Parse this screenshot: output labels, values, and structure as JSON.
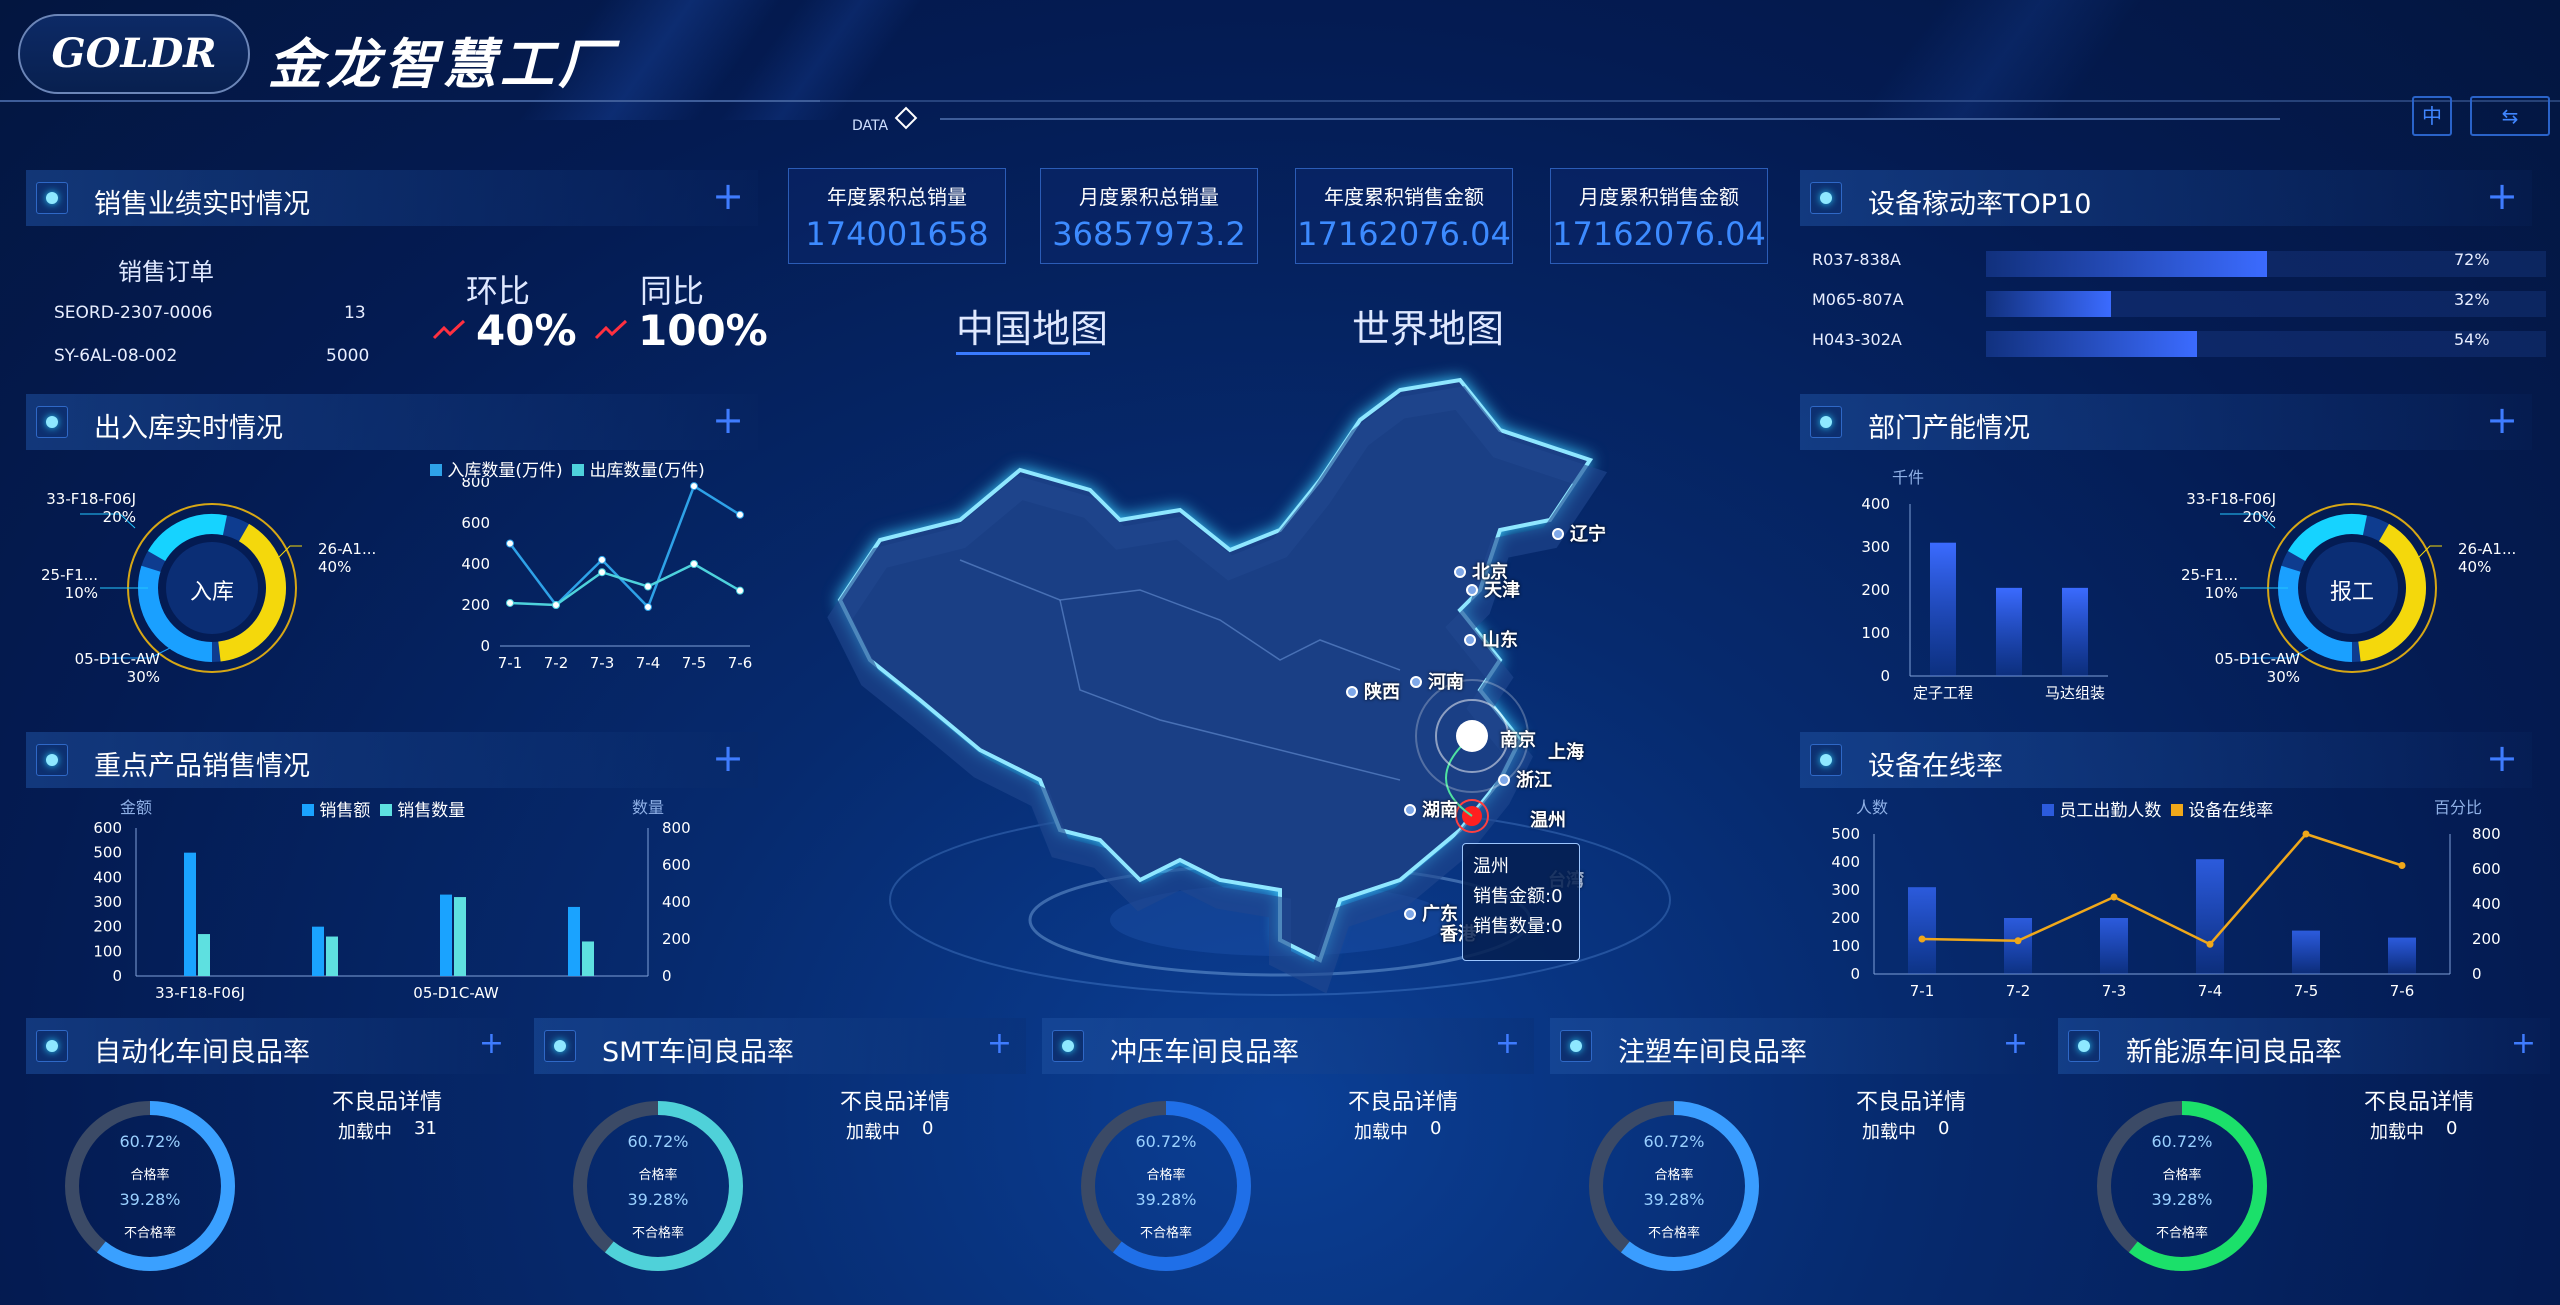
{
  "header": {
    "logo": "GOLDR",
    "title": "金龙智慧工厂",
    "data_label": "DATA",
    "icons": [
      "translate-icon",
      "switch-icon"
    ]
  },
  "sales": {
    "title": "销售业绩实时情况",
    "orders_title": "销售订单",
    "orders": [
      {
        "id": "SEORD-2307-0006",
        "qty": "13"
      },
      {
        "id": "SY-6AL-08-002",
        "qty": "5000"
      }
    ],
    "mom_label": "环比",
    "mom_value": "40%",
    "yoy_label": "同比",
    "yoy_value": "100%"
  },
  "kpis": [
    {
      "label": "年度累积总销量",
      "value": "174001658"
    },
    {
      "label": "月度累积总销量",
      "value": "36857973.2"
    },
    {
      "label": "年度累积销售金额",
      "value": "17162076.04"
    },
    {
      "label": "月度累积销售金额",
      "value": "17162076.04"
    }
  ],
  "map": {
    "tab_china": "中国地图",
    "tab_world": "世界地图",
    "cities": [
      "辽宁",
      "北京",
      "天津",
      "山东",
      "河南",
      "陕西",
      "南京",
      "上海",
      "浙江",
      "湖南",
      "温州",
      "台湾",
      "广东",
      "香港"
    ],
    "tooltip": {
      "city": "温州",
      "amount_label": "销售金额:",
      "amount": "0",
      "qty_label": "销售数量:",
      "qty": "0"
    }
  },
  "warehouse": {
    "title": "出入库实时情况",
    "donut_center": "入库",
    "segments": [
      {
        "name": "33-F18-F06J",
        "pct": "20%"
      },
      {
        "name": "26-A1...",
        "pct": "40%"
      },
      {
        "name": "25-F1...",
        "pct": "10%"
      },
      {
        "name": "05-D1C-AW",
        "pct": "30%"
      }
    ],
    "chart_data": {
      "type": "line",
      "x": [
        "7-1",
        "7-2",
        "7-3",
        "7-4",
        "7-5",
        "7-6"
      ],
      "series": [
        {
          "name": "入库数量(万件)",
          "values": [
            500,
            200,
            420,
            190,
            780,
            640
          ],
          "color": "#2ea2e8"
        },
        {
          "name": "出库数量(万件)",
          "values": [
            210,
            200,
            360,
            290,
            400,
            270
          ],
          "color": "#4ed2dc"
        }
      ],
      "ylim": [
        0,
        800
      ],
      "yticks": [
        "0",
        "200",
        "400",
        "600",
        "800"
      ]
    }
  },
  "products": {
    "title": "重点产品销售情况",
    "ylabel_left": "金额",
    "ylabel_right": "数量",
    "chart_data": {
      "type": "bar",
      "categories": [
        "33-F18-F06J",
        "",
        "05-D1C-AW",
        ""
      ],
      "tick_labels": [
        "33-F18-F06J",
        "05-D1C-AW"
      ],
      "series": [
        {
          "name": "销售额",
          "values": [
            500,
            200,
            330,
            280
          ],
          "color": "#1aa3ff"
        },
        {
          "name": "销售数量",
          "values": [
            170,
            160,
            320,
            140
          ],
          "color": "#5ee0e0"
        }
      ],
      "ylim_left": [
        0,
        600
      ],
      "yticks_left": [
        "0",
        "100",
        "200",
        "300",
        "400",
        "500",
        "600"
      ],
      "yticks_right": [
        "0",
        "200",
        "400",
        "600",
        "800"
      ]
    }
  },
  "equipment": {
    "title": "设备稼动率TOP10",
    "rows": [
      {
        "name": "R037-838A",
        "pct": "72%",
        "value": 72
      },
      {
        "name": "M065-807A",
        "pct": "32%",
        "value": 32
      },
      {
        "name": "H043-302A",
        "pct": "54%",
        "value": 54
      }
    ]
  },
  "dept": {
    "title": "部门产能情况",
    "ylabel": "千件",
    "chart_data": {
      "type": "bar",
      "categories": [
        "定子工程",
        "",
        "马达组装"
      ],
      "values": [
        310,
        205,
        205
      ],
      "ylim": [
        0,
        400
      ],
      "yticks": [
        "0",
        "100",
        "200",
        "300",
        "400"
      ],
      "tick_labels": [
        "定子工程",
        "马达组装"
      ]
    },
    "donut_center": "报工",
    "segments": [
      {
        "name": "33-F18-F06J",
        "pct": "20%"
      },
      {
        "name": "26-A1...",
        "pct": "40%"
      },
      {
        "name": "25-F1...",
        "pct": "10%"
      },
      {
        "name": "05-D1C-AW",
        "pct": "30%"
      }
    ]
  },
  "online": {
    "title": "设备在线率",
    "ylabel_left": "人数",
    "ylabel_right": "百分比",
    "chart_data": {
      "type": "bar",
      "x": [
        "7-1",
        "7-2",
        "7-3",
        "7-4",
        "7-5",
        "7-6"
      ],
      "series": [
        {
          "name": "员工出勤人数",
          "values": [
            310,
            200,
            200,
            410,
            155,
            130
          ],
          "color": "#2c5bdc"
        },
        {
          "name": "设备在线率",
          "values": [
            200,
            190,
            440,
            170,
            800,
            620
          ],
          "color": "#f0a81a"
        }
      ],
      "yticks_left": [
        "0",
        "100",
        "200",
        "300",
        "400",
        "500"
      ],
      "yticks_right": [
        "0",
        "200",
        "400",
        "600",
        "800"
      ]
    }
  },
  "quality": [
    {
      "title": "自动化车间良品率",
      "pass": "60.72%",
      "pass_label": "合格率",
      "fail": "39.28%",
      "fail_label": "不合格率",
      "detail": "不良品详情",
      "loading": "加载中",
      "count": "31",
      "color": "#3aa0ff"
    },
    {
      "title": "SMT车间良品率",
      "pass": "60.72%",
      "pass_label": "合格率",
      "fail": "39.28%",
      "fail_label": "不合格率",
      "detail": "不良品详情",
      "loading": "加载中",
      "count": "0",
      "color": "#4fd1d9"
    },
    {
      "title": "冲压车间良品率",
      "pass": "60.72%",
      "pass_label": "合格率",
      "fail": "39.28%",
      "fail_label": "不合格率",
      "detail": "不良品详情",
      "loading": "加载中",
      "count": "0",
      "color": "#1f6fe8"
    },
    {
      "title": "注塑车间良品率",
      "pass": "60.72%",
      "pass_label": "合格率",
      "fail": "39.28%",
      "fail_label": "不合格率",
      "detail": "不良品详情",
      "loading": "加载中",
      "count": "0",
      "color": "#3a9dff"
    },
    {
      "title": "新能源车间良品率",
      "pass": "60.72%",
      "pass_label": "合格率",
      "fail": "39.28%",
      "fail_label": "不合格率",
      "detail": "不良品详情",
      "loading": "加载中",
      "count": "0",
      "color": "#1be06a"
    }
  ]
}
